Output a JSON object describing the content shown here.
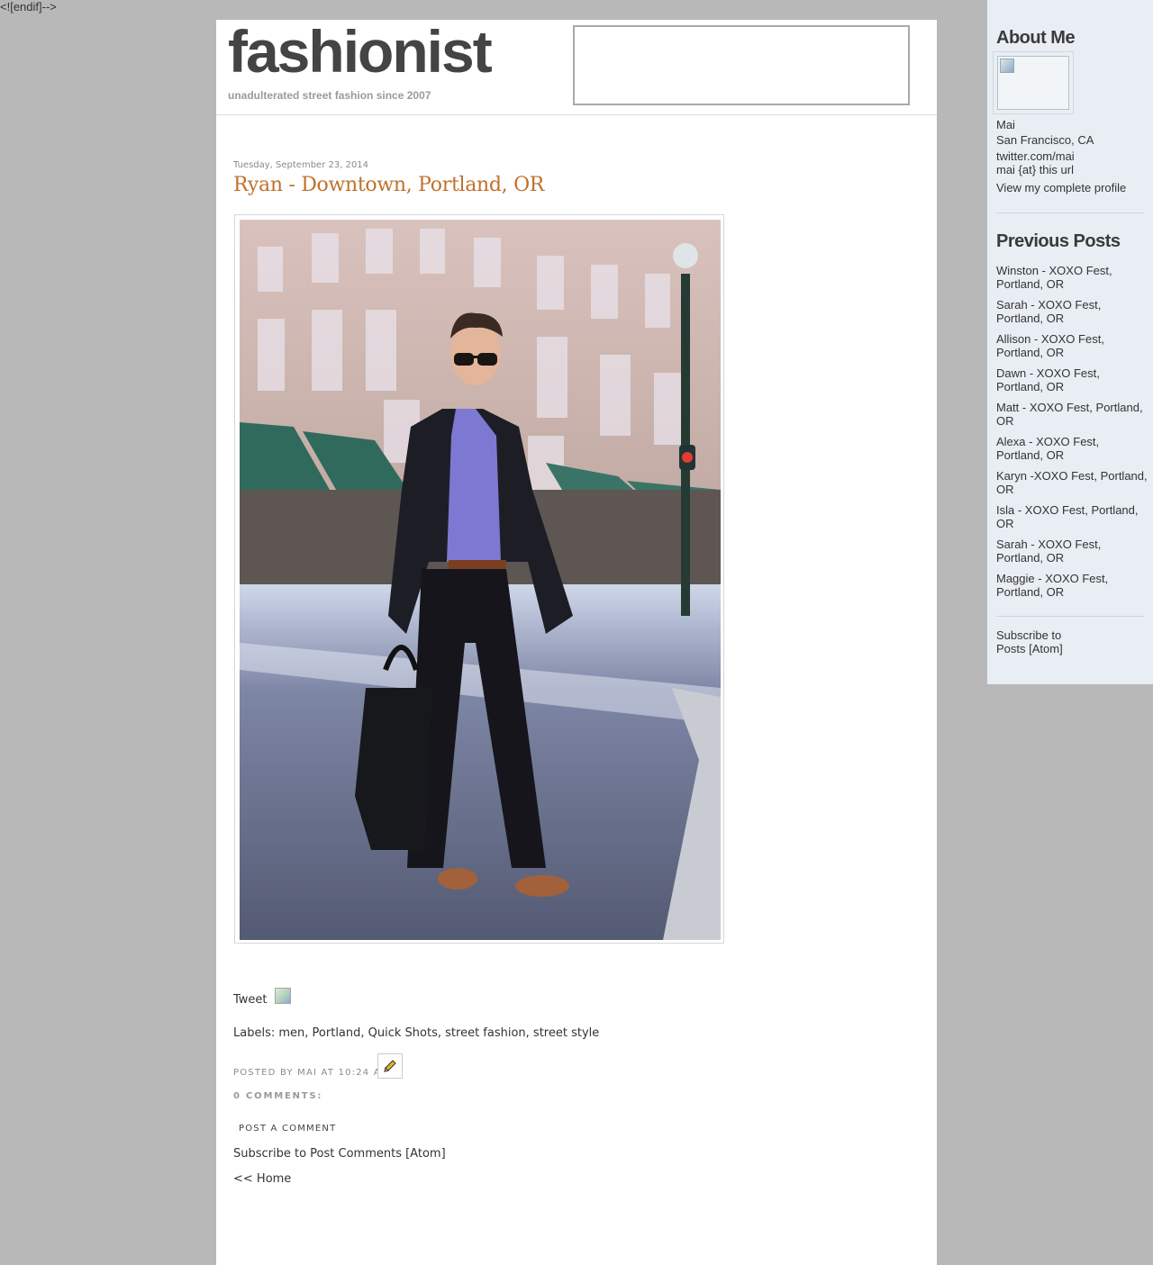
{
  "stray_text": "<![endif]-->",
  "header": {
    "logo": "fashionist",
    "tagline": "unadulterated street fashion since 2007"
  },
  "post": {
    "date": "Tuesday, September 23, 2014",
    "title": "Ryan - Downtown, Portland, OR",
    "tweet_label": "Tweet",
    "labels_prefix": "Labels:",
    "labels": [
      "men",
      "Portland",
      "Quick Shots",
      "street fashion",
      "street style"
    ],
    "posted_by": "POSTED BY MAI AT 10:24 AM",
    "comments_count": "0 COMMENTS:",
    "post_comment": "POST A COMMENT",
    "subscribe_comments": "Subscribe to Post Comments [Atom]",
    "home_link": "<< Home"
  },
  "sidebar": {
    "about_heading": "About Me",
    "name": "Mai",
    "location": "San Francisco, CA",
    "twitter": "twitter.com/mai",
    "email": "mai {at} this url",
    "profile_link": "View my complete profile",
    "previous_heading": "Previous Posts",
    "previous_posts": [
      "Winston - XOXO Fest, Portland, OR",
      "Sarah - XOXO Fest, Portland, OR",
      "Allison - XOXO Fest, Portland, OR",
      "Dawn - XOXO Fest, Portland, OR",
      "Matt - XOXO Fest, Portland, OR",
      "Alexa - XOXO Fest, Portland, OR",
      "Karyn -XOXO Fest, Portland, OR",
      "Isla - XOXO Fest, Portland, OR",
      "Sarah - XOXO Fest, Portland, OR",
      "Maggie - XOXO Fest, Portland, OR"
    ],
    "subscribe": "Subscribe to Posts [Atom]"
  },
  "icons": {
    "edit": "pencil-icon",
    "broken_image": "broken-image-icon"
  },
  "colors": {
    "page_bg": "#b8b8b8",
    "sidebar_bg": "#e9eef4",
    "title_accent": "#c0712b",
    "logo": "#444444"
  }
}
